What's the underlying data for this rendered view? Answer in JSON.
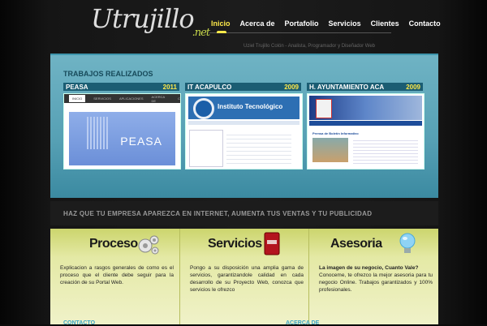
{
  "logo": {
    "main": "Utrujillo",
    "suffix": ".net"
  },
  "nav": {
    "items": [
      "Inicio",
      "Acerca de",
      "Portafolio",
      "Servicios",
      "Clientes",
      "Contacto"
    ]
  },
  "tagline": "Uziel Trujillo Colón - Analista, Programador y Diseñador Web",
  "works": {
    "title": "TRABAJOS REALIZADOS",
    "cards": [
      {
        "name": "PEASA",
        "year": "2011",
        "thumb_text": "PEASA",
        "thumb_tabs": [
          "INICIO",
          "SERVICIOS",
          "APLICACIONES",
          "ACERCA DE",
          "C"
        ]
      },
      {
        "name": "IT ACAPULCO",
        "year": "2009",
        "thumb_text": "Instituto Tecnológico"
      },
      {
        "name": "H. AYUNTAMIENTO ACA",
        "year": "2009",
        "thumb_text": "Prensa de Boletín Informativo"
      }
    ]
  },
  "promo": "HAZ QUE TU EMPRESA APAREZCA EN INTERNET, AUMENTA TUS VENTAS Y TU PUBLICIDAD",
  "features": [
    {
      "title": "Proceso",
      "icon": "gears-icon",
      "text": "Explicacion a rasgos generales de como es el proceso que el cliente debe seguir para la creación de su Portal Web."
    },
    {
      "title": "Servicios",
      "icon": "portfolio-book-icon",
      "text": "Pongo a su disposición una amplia gama de servicios, garantizandole calidad en cada desarrollo de su Proyecto Web, conozca que servicios le ofrezco"
    },
    {
      "title": "Asesoria",
      "icon": "lightbulb-icon",
      "bold": "La imagen de su negocio, Cuanto Vale?",
      "text": "Conoceme, te ofrezco la mejor asesoria para tu negocio Online. Trabajos garantizados y 100% profesionales."
    }
  ],
  "footer": {
    "left": "CONTACTO",
    "right": "ACERCA DE"
  }
}
